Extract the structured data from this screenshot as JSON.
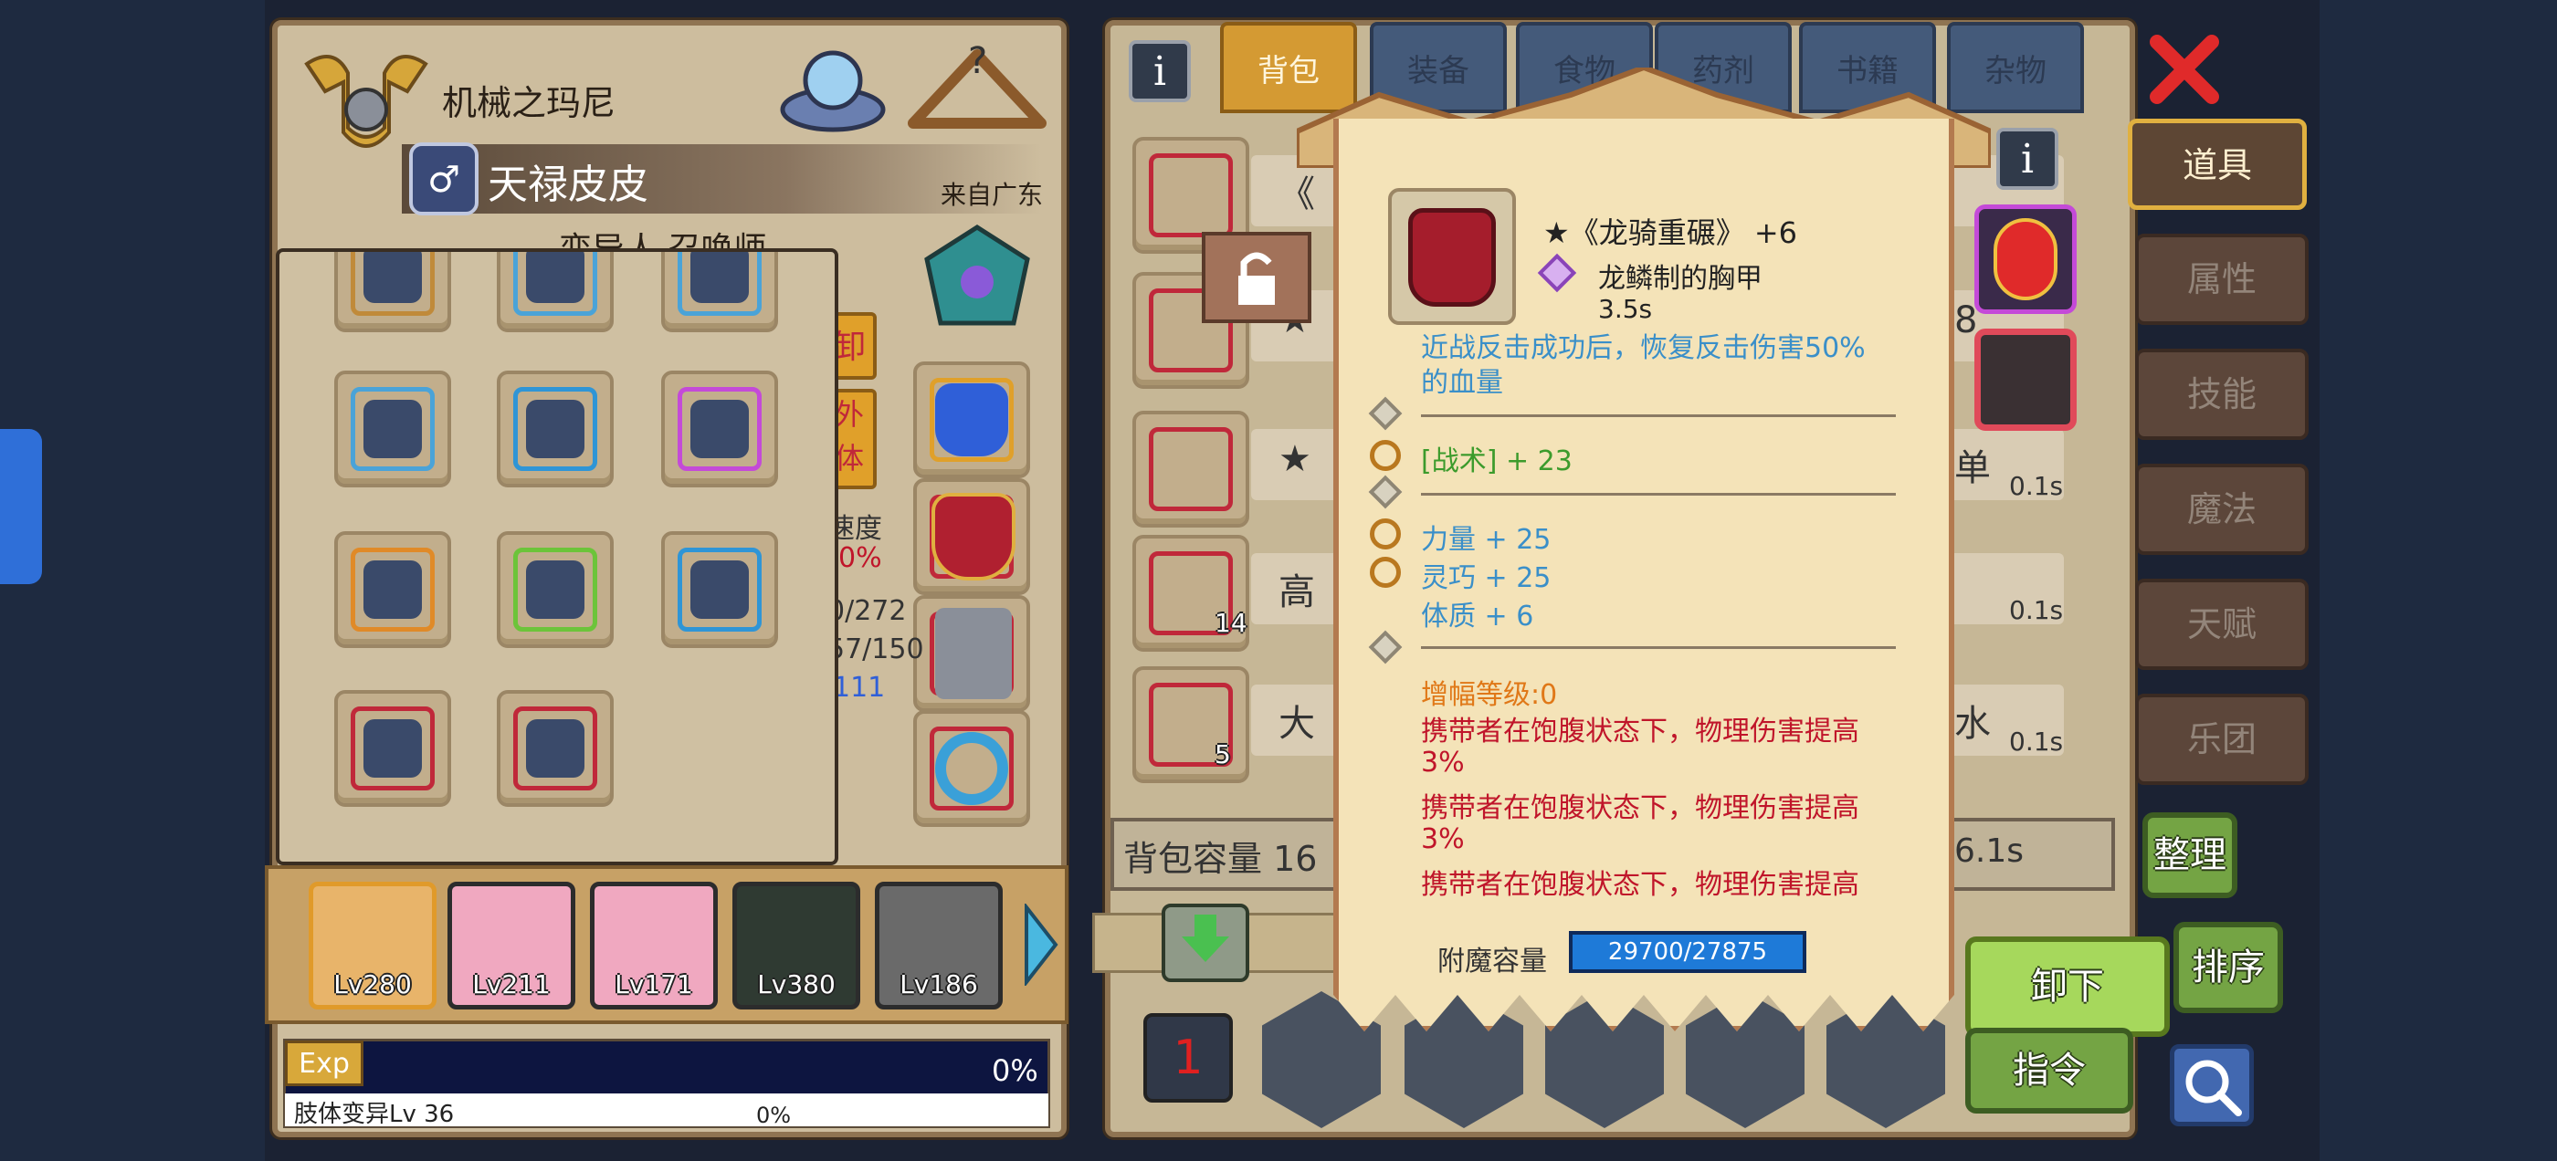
{
  "character": {
    "guild_name": "机械之玛尼",
    "name": "天禄皮皮",
    "origin": "来自广东",
    "class": "变异人 召唤师",
    "side_labels": {
      "unequip": "卸",
      "appearance": "外\n体",
      "stat_label": "速度",
      "stat_pct": "0%",
      "hp_partial": "0/272",
      "mp_partial": "57/150",
      "num_partial": "111"
    },
    "exp_label": "Exp",
    "exp_pct": "0%",
    "skill_line": "肢体变异Lv 36",
    "skill_pct": "0%",
    "portraits": [
      {
        "level": "Lv280"
      },
      {
        "level": "Lv211"
      },
      {
        "level": "Lv171"
      },
      {
        "level": "Lv380"
      },
      {
        "level": "Lv186"
      }
    ]
  },
  "equipment_grid": [
    {
      "icon": "tank-icon",
      "frame_color": "#c08a3a"
    },
    {
      "icon": "gear-orb-icon",
      "frame_color": "#4aa3d8"
    },
    {
      "icon": "gear-orb-icon",
      "frame_color": "#4aa3d8"
    },
    {
      "icon": "gear-orb-icon",
      "frame_color": "#4aa3d8"
    },
    {
      "icon": "pistol-icon",
      "frame_color": "#2f95d6"
    },
    {
      "icon": "branch-icon",
      "frame_color": "#c44ad8"
    },
    {
      "icon": "branch-icon",
      "frame_color": "#e08a28"
    },
    {
      "icon": "branch-icon",
      "frame_color": "#6cc43a"
    },
    {
      "icon": "chip-icon",
      "frame_color": "#2f95d6"
    },
    {
      "icon": "chestplate-icon",
      "frame_color": "#c0283a"
    },
    {
      "icon": "golden-armor-icon",
      "frame_color": "#c0283a"
    }
  ],
  "inventory": {
    "tabs": [
      "背包",
      "装备",
      "食物",
      "药剂",
      "书籍",
      "杂物"
    ],
    "active_tab": "背包",
    "capacity_label": "背包容量 16",
    "rows": [
      {
        "text": "《",
        "right": ""
      },
      {
        "text": "★",
        "right": "8"
      },
      {
        "text": "★",
        "right": "单",
        "time": "0.1s"
      },
      {
        "text": "高",
        "right": "",
        "time": "0.1s",
        "count": "14"
      },
      {
        "text": "大",
        "right": "水",
        "time": "0.1s",
        "count": "5"
      }
    ],
    "footer_time": "6.1s"
  },
  "side_menu": [
    "道具",
    "属性",
    "技能",
    "魔法",
    "天赋",
    "乐团"
  ],
  "side_menu_active": "道具",
  "buttons": {
    "sort_label": "整理",
    "order_label": "排序",
    "unequip_label": "卸下",
    "command_label": "指令"
  },
  "tooltip": {
    "item_name": "★《龙骑重碾》 +6",
    "item_type": "龙鳞制的胸甲",
    "item_time": "3.5s",
    "cut_line": "近战反击成功后，恢复反击伤害50%",
    "line2": "的血量",
    "tactic": "[战术] + 23",
    "strength": "力量 + 25",
    "agility": "灵巧 + 25",
    "constitution": "体质 + 6",
    "amp_level": "增幅等级:0",
    "bonus_lines": [
      "携带者在饱腹状态下，物理伤害提高",
      "3%",
      "携带者在饱腹状态下，物理伤害提高",
      "3%",
      "携带者在饱腹状态下，物理伤害提高"
    ],
    "enchant_label": "附魔容量",
    "enchant_value": "29700/27875"
  },
  "colors": {
    "panel": "#cdbd9e",
    "accent": "#d49a33",
    "tooltip_bg": "#f4e3b8"
  }
}
